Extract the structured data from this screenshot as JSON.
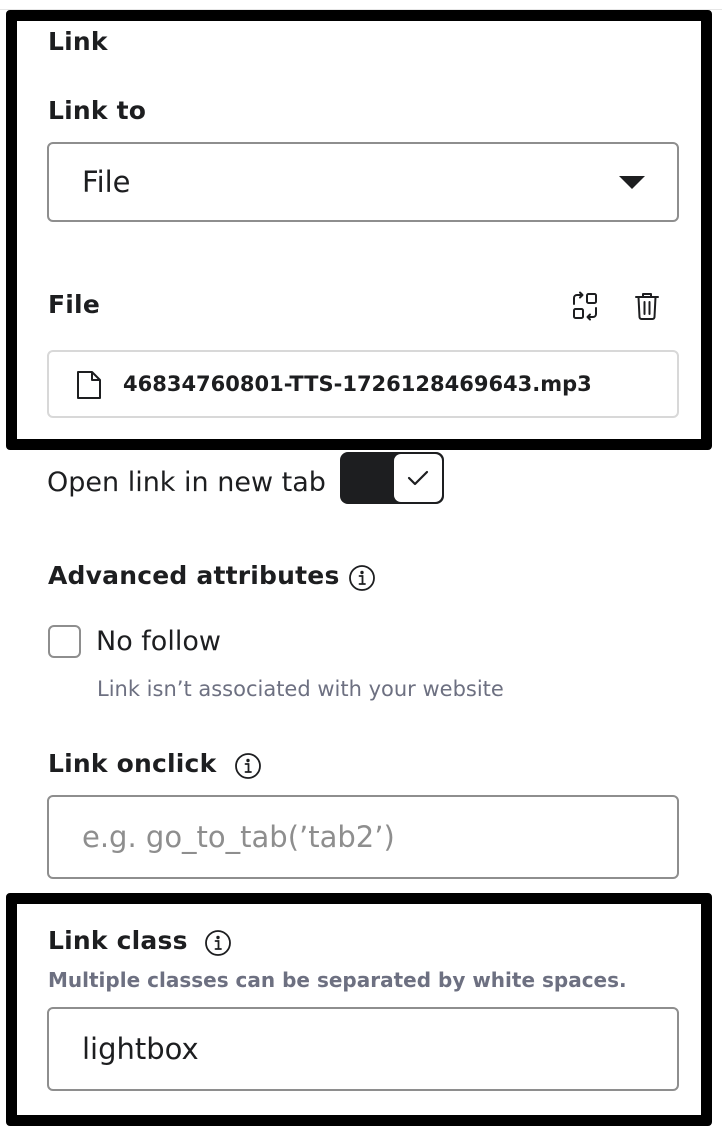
{
  "link_section": {
    "title": "Link",
    "link_to_label": "Link to",
    "link_to_value": "File"
  },
  "file_section": {
    "title": "File",
    "replace_icon": "replace-icon",
    "delete_icon": "trash-icon",
    "file_icon": "file-icon",
    "file_name": "46834760801-TTS-1726128469643.mp3"
  },
  "new_tab": {
    "label": "Open link in new tab",
    "enabled": true
  },
  "advanced": {
    "title": "Advanced attributes",
    "no_follow_label": "No follow",
    "no_follow_checked": false,
    "no_follow_help": "Link isn’t associated with your website"
  },
  "onclick": {
    "title": "Link onclick",
    "placeholder": "e.g. go_to_tab(’tab2’)",
    "value": ""
  },
  "link_class": {
    "title": "Link class",
    "help": "Multiple classes can be separated by white spaces.",
    "value": "lightbox"
  }
}
